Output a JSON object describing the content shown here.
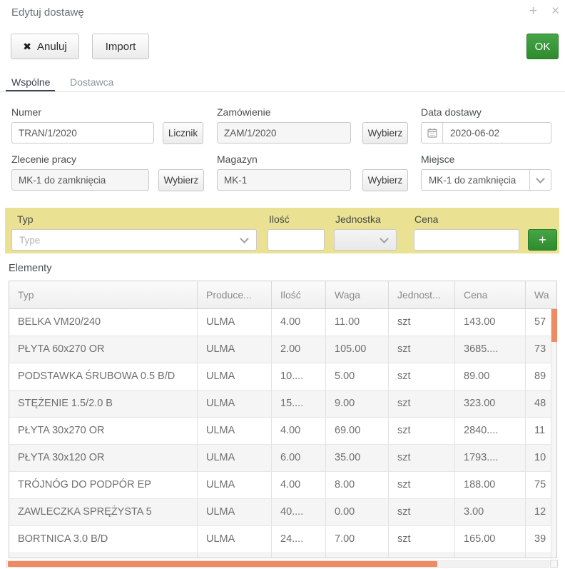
{
  "dialog": {
    "title": "Edytuj dostawę",
    "plus_icon": "+",
    "close_icon": "×"
  },
  "toolbar": {
    "cancel_icon": "✖",
    "cancel_label": "Anuluj",
    "import_label": "Import",
    "ok_label": "OK"
  },
  "tabs": [
    {
      "label": "Wspólne",
      "active": true
    },
    {
      "label": "Dostawca",
      "active": false
    }
  ],
  "form": {
    "numer": {
      "label": "Numer",
      "value": "TRAN/1/2020",
      "button": "Licznik"
    },
    "zamowienie": {
      "label": "Zamówienie",
      "value": "ZAM/1/2020",
      "button": "Wybierz"
    },
    "data_dostawy": {
      "label": "Data dostawy",
      "value": "2020-06-02"
    },
    "zlecenie_pracy": {
      "label": "Zlecenie pracy",
      "value": "MK-1 do zamknięcia",
      "button": "Wybierz"
    },
    "magazyn": {
      "label": "Magazyn",
      "value": "MK-1",
      "button": "Wybierz"
    },
    "miejsce": {
      "label": "Miejsce",
      "value": "MK-1 do zamknięcia"
    }
  },
  "add_row": {
    "typ_label": "Typ",
    "typ_placeholder": "Type",
    "ilosc_label": "Ilość",
    "ilosc_value": "",
    "jednostka_label": "Jednostka",
    "cena_label": "Cena",
    "cena_value": "",
    "add_button": "+"
  },
  "elements": {
    "label": "Elementy",
    "columns": [
      "Typ",
      "Produce...",
      "Ilość",
      "Waga",
      "Jednost...",
      "Cena",
      "Wa"
    ],
    "rows": [
      [
        "BELKA VM20/240",
        "ULMA",
        "4.00",
        "11.00",
        "szt",
        "143.00",
        "57"
      ],
      [
        "PŁYTA 60x270 OR",
        "ULMA",
        "2.00",
        "105.00",
        "szt",
        "3685....",
        "73"
      ],
      [
        "PODSTAWKA ŚRUBOWA 0.5 B/D",
        "ULMA",
        "10....",
        "5.00",
        "szt",
        "89.00",
        "89"
      ],
      [
        "STĘŻENIE 1.5/2.0 B",
        "ULMA",
        "15....",
        "9.00",
        "szt",
        "323.00",
        "48"
      ],
      [
        "PŁYTA 30x270 OR",
        "ULMA",
        "4.00",
        "69.00",
        "szt",
        "2840....",
        "11"
      ],
      [
        "PŁYTA 30x120 OR",
        "ULMA",
        "6.00",
        "35.00",
        "szt",
        "1793....",
        "10"
      ],
      [
        "TRÓJNÓG DO PODPÓR EP",
        "ULMA",
        "4.00",
        "8.00",
        "szt",
        "188.00",
        "75"
      ],
      [
        "ZAWLECZKA SPRĘŻYSTA 5",
        "ULMA",
        "40....",
        "0.00",
        "szt",
        "3.00",
        "12"
      ],
      [
        "BORTNICA 3.0 B/D",
        "ULMA",
        "24....",
        "7.00",
        "szt",
        "165.00",
        "39"
      ]
    ]
  },
  "colors": {
    "ok_green": "#2e8b2e",
    "add_green": "#2e8b2e",
    "highlight_yellow": "#eae292",
    "scrollbar_orange": "#ef8a63",
    "tab_active": "#3e4354"
  }
}
